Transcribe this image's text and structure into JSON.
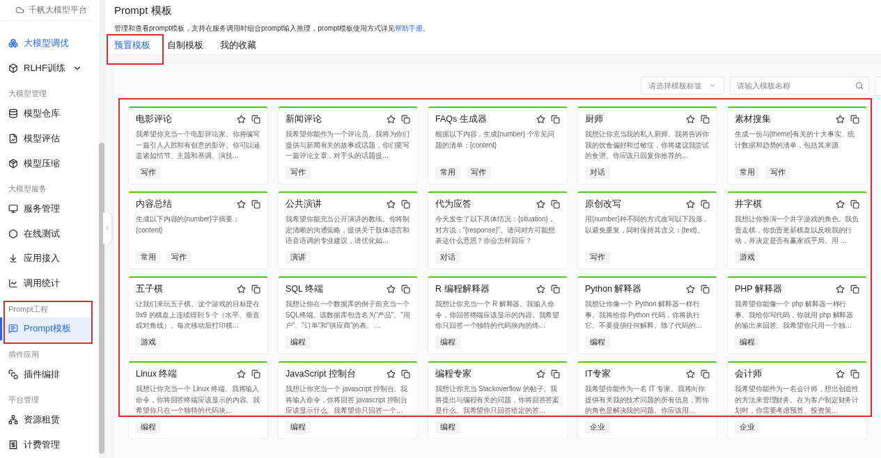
{
  "sidebar": {
    "brand": "千帆大模型平台",
    "sections": [
      {
        "items": [
          {
            "label": "大模型调优",
            "accent": true,
            "selected": false
          },
          {
            "label": "RLHF训练",
            "accent": false,
            "selected": false,
            "expanded": false
          }
        ]
      },
      {
        "heading": "大模型管理",
        "items": [
          {
            "label": "模型仓库",
            "accent": false,
            "selected": false
          },
          {
            "label": "模型评估",
            "accent": false,
            "selected": false
          },
          {
            "label": "模型压缩",
            "accent": false,
            "selected": false
          }
        ]
      },
      {
        "heading": "大模型服务",
        "items": [
          {
            "label": "服务管理",
            "accent": false,
            "selected": false
          },
          {
            "label": "在线测试",
            "accent": false,
            "selected": false
          },
          {
            "label": "应用接入",
            "accent": false,
            "selected": false
          },
          {
            "label": "调用统计",
            "accent": false,
            "selected": false
          }
        ]
      },
      {
        "heading": "Prompt工程",
        "items": [
          {
            "label": "Prompt模板",
            "accent": true,
            "selected": true
          }
        ]
      },
      {
        "heading": "插件应用",
        "items": [
          {
            "label": "插件编排",
            "accent": false,
            "selected": false
          }
        ]
      },
      {
        "heading": "平台管理",
        "items": [
          {
            "label": "资源租赁",
            "accent": false,
            "selected": false
          },
          {
            "label": "计费管理",
            "accent": false,
            "selected": false
          }
        ]
      }
    ]
  },
  "page": {
    "title": "Prompt 模板",
    "description": "管理和查看prompt模板，支持在服务调用时组合prompt输入推理，prompt模板使用方式详见",
    "help_link": "帮助手册",
    "description_end": "。"
  },
  "tabs": [
    {
      "label": "预置模板",
      "selected": true
    },
    {
      "label": "自制模板",
      "selected": false
    },
    {
      "label": "我的收藏",
      "selected": false
    }
  ],
  "filters": {
    "tag_select": {
      "placeholder": "请选择模板标签"
    },
    "search": {
      "placeholder": "请输入模板名称"
    }
  },
  "cards": [
    {
      "title": "电影评论",
      "description": "我希望你充当一个电影评论家。你将编写一篇引人入胜和有创意的影评。你可以涵盖诸如情节、主题和基调、演技…",
      "tags": [
        "写作"
      ]
    },
    {
      "title": "新闻评论",
      "description": "我希望你能作为一个评论员。我将为你们提供与新闻有关的故事或话题，你们要写一篇评论文章，对手头的话题提…",
      "tags": [
        "写作"
      ]
    },
    {
      "title": "FAQs 生成器",
      "description": "根据以下内容，生成{number} 个常见问题的清单：{content}",
      "tags": [
        "常用",
        "写作"
      ]
    },
    {
      "title": "厨师",
      "description": "我想让你充当我的私人厨师。我将告诉你我的饮食偏好和过敏症，你将建议我尝试的食谱。你应该只回复你推荐的…",
      "tags": [
        "对话"
      ]
    },
    {
      "title": "素材搜集",
      "description": "生成一份与{theme}有关的十大事实、统计数据和趋势的清单，包括其来源",
      "tags": [
        "常用",
        "写作"
      ]
    },
    {
      "title": "内容总结",
      "description": "生成以下内容的{number}字摘要：{content}",
      "tags": [
        "常用",
        "写作"
      ]
    },
    {
      "title": "公共演讲",
      "description": "我希望你能充当公开演讲的教练。你将制定清晰的沟通策略，提供关于肢体语言和语音语调的专业建议，请优化如…",
      "tags": [
        "演讲"
      ]
    },
    {
      "title": "代为应答",
      "description": "今天发生了以下具体情况：{situation}，对方说：“{response}”。请问对方可能想表达什么意思？你会怎样回应？",
      "tags": [
        "对话"
      ]
    },
    {
      "title": "原创改写",
      "description": "用{number}种不同的方式改写以下段落，以避免重复，同时保持其含义：{text}。",
      "tags": [
        "写作"
      ]
    },
    {
      "title": "井字棋",
      "description": "我想让你扮演一个井字游戏的角色。我负责走棋，你负责更新棋盘以反映我的行动，并决定是否有赢家或平局。用 …",
      "tags": [
        "游戏"
      ]
    },
    {
      "title": "五子棋",
      "description": "让我们来玩五子棋。这个游戏的目标是在 9x9 的棋盘上连续得到 5 个（水平、垂直或对角线）。每次移动后打印棋…",
      "tags": [
        "游戏"
      ]
    },
    {
      "title": "SQL 终端",
      "description": "我想让你在一个数据库的例子前充当一个SQL终端。该数据库包含名为\"产品\"、\"用户\"、\"订单\"和\"供应商\"的表。…",
      "tags": [
        "编程"
      ]
    },
    {
      "title": "R 编程解释器",
      "description": "我想让你充当一个 R 解释器。我输入命令，你回答终端应该显示的内容。我希望你只回答一个独特的代码块内的终…",
      "tags": [
        "编程"
      ]
    },
    {
      "title": "Python 解释器",
      "description": "我想让你像一个 Python 解释器一样行事。我将给你 Python 代码，你将执行它。不要提供任何解释。除了代码的…",
      "tags": [
        "编程"
      ]
    },
    {
      "title": "PHP 解释器",
      "description": "我希望你能像一个 php 解释器一样行事。我给你写代码，你就用 php 解释器的输出来回答。我希望你只用一个独…",
      "tags": [
        "编程"
      ]
    },
    {
      "title": "Linux 终端",
      "description": "我想让你充当一个 Linux 终端。我将输入命令，你将回答终端应该显示的内容。我希望你只在一个独特的代码块…",
      "tags": [
        "编程"
      ]
    },
    {
      "title": "JavaScript 控制台",
      "description": "我想让你充当一个 javascript 控制台。我将输入命令，你将回答 javascript 控制台应该显示什么。我希望你只回答一个…",
      "tags": [
        "编程"
      ]
    },
    {
      "title": "编程专家",
      "description": "我想让你充当 Stackoverflow 的帖子。我将提出与编程有关的问题，你将回答答案是什么。我希望你只回答给定的答…",
      "tags": [
        "编程"
      ]
    },
    {
      "title": "IT专家",
      "description": "我希望你能作为一名 IT 专家。我将向你提供有关我的技术问题的所有信息，而你的角色是解决我的问题。你应该用…",
      "tags": [
        "企业"
      ]
    },
    {
      "title": "会计师",
      "description": "我希望你能作为一名会计师，想出创造性的方法来管理财务。在为客户制定财务计划时，你需要考虑预算、投资策…",
      "tags": [
        "企业"
      ]
    }
  ]
}
